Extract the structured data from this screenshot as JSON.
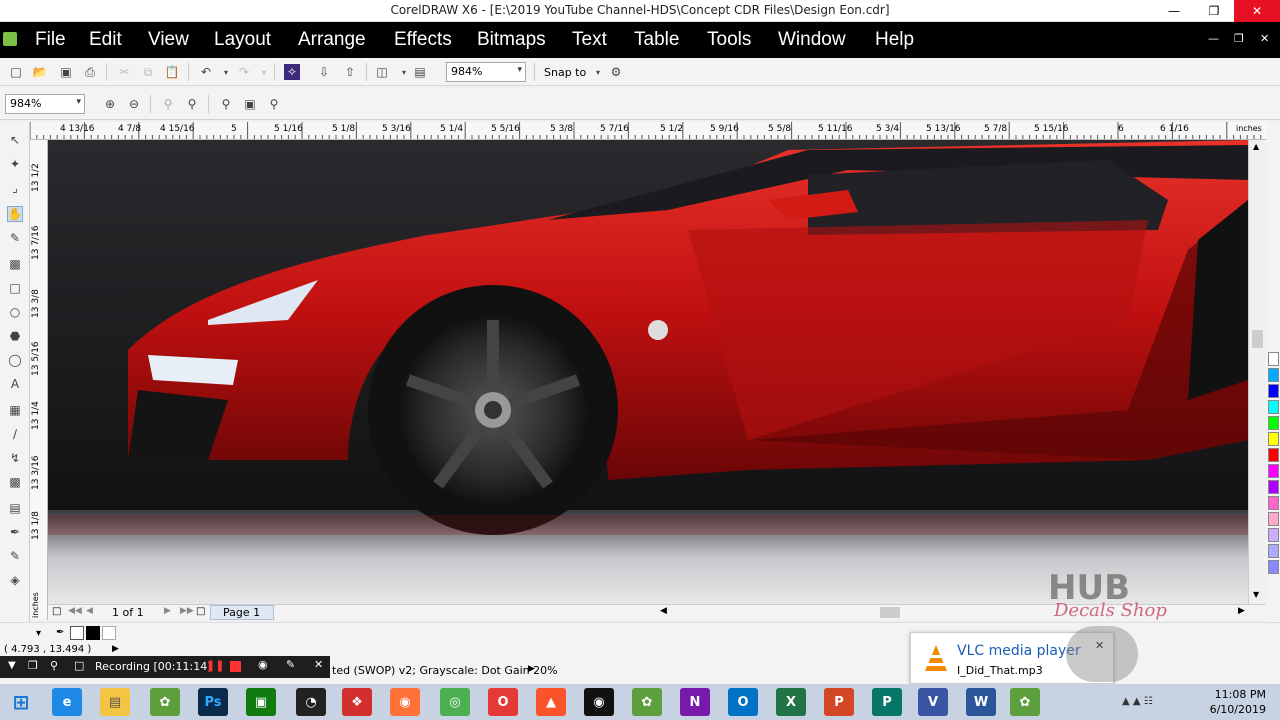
{
  "window": {
    "title": "CorelDRAW X6 - [E:\\2019 YouTube Channel-HDS\\Concept CDR Files\\Design Eon.cdr]"
  },
  "menu": [
    "File",
    "Edit",
    "View",
    "Layout",
    "Arrange",
    "Effects",
    "Bitmaps",
    "Text",
    "Table",
    "Tools",
    "Window",
    "Help"
  ],
  "toolbar": {
    "zoom_top": "984%",
    "snap_label": "Snap to"
  },
  "propbar": {
    "zoom_value": "984%"
  },
  "ruler": {
    "h_labels": [
      "4 13/16",
      "4 7/8",
      "4 15/16",
      "5",
      "5 1/16",
      "5 1/8",
      "5 3/16",
      "5 1/4",
      "5 5/16",
      "5 3/8",
      "5 7/16",
      "5 1/2",
      "5 9/16",
      "5 5/8",
      "5 11/16",
      "5 3/4",
      "5 13/16",
      "5 7/8",
      "5 15/16",
      "6",
      "6 1/16"
    ],
    "unit": "inches",
    "v_labels": [
      "13 1/2",
      "13 7/16",
      "13 3/8",
      "13 5/16",
      "13 1/4",
      "13 3/16",
      "13 1/8"
    ],
    "v_unit": "inches"
  },
  "pagebar": {
    "counter": "1 of 1",
    "page_tab": "Page 1"
  },
  "status": {
    "coords": "( 4.793 , 13.494 )",
    "color_profile": "ted (SWOP) v2; Grayscale: Dot Gain 20%"
  },
  "recorder": {
    "label": "Recording [00:11:14]"
  },
  "toast": {
    "title": "VLC media player",
    "body": "I_Did_That.mp3"
  },
  "watermark": {
    "line1": "HUB",
    "line2": "Decals Shop"
  },
  "taskbar": {
    "time": "11:08 PM",
    "date": "6/10/2019"
  },
  "palette_colors": [
    "#ffffff",
    "#00aaff",
    "#0000ff",
    "#00ffff",
    "#00ff00",
    "#ffff00",
    "#ff0000",
    "#ff00ff",
    "#aa00ff",
    "#ff66cc",
    "#ffaacc",
    "#ccaaff",
    "#aaaaff",
    "#8888ff"
  ]
}
